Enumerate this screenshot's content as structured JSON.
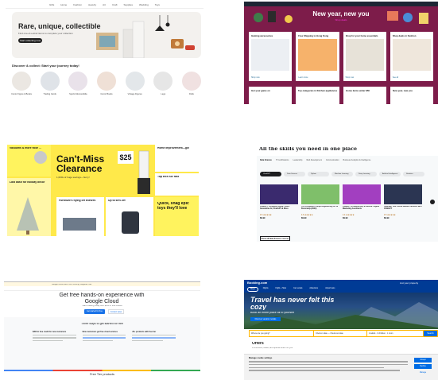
{
  "etsy": {
    "nav": [
      "Gifts",
      "Home",
      "Fashion",
      "Jewelry",
      "Art",
      "Craft",
      "Supplies",
      "Wedding",
      "Toys"
    ],
    "hero_title": "Rare, unique, collectible",
    "hero_sub": "Find one-of-a-kind items to complete your collection",
    "hero_cta": "Start collecting now",
    "journey": "Discover & collect: Start your journey today!",
    "circles": [
      "Comic Figure & Books",
      "Trading Cards",
      "Sports Memorabilia",
      "Comic Books",
      "Vintage Figures",
      "Lego",
      "Dolls"
    ]
  },
  "newyear": {
    "title": "New year, new you",
    "subtitle": "Shop deals",
    "cards": [
      {
        "title": "Gaming accessories",
        "link": "Shop now"
      },
      {
        "title": "Free Shipping to Hong Kong",
        "link": "Learn more"
      },
      {
        "title": "Shop for your home essentials",
        "link": "Shop now"
      },
      {
        "title": "Shop deals in Fashion",
        "link": "See all"
      }
    ],
    "row2": [
      "Get your game on",
      "Top categories in Kitchen appliances",
      "Home items under $50",
      "New year, new you"
    ]
  },
  "clearance": {
    "left_title": "Vacuums & more floor ...",
    "left_dash": "Last dash for holiday decor",
    "big": "Can't-Miss Clearance",
    "big_sub": "1,000s of huge savings—hurry!",
    "price": "$25",
    "home_title": "Home improvement—go!",
    "tech_title": "Top tech so! fast",
    "furniture_title": "Furniture's flying off shelves",
    "upto": "Up to 65% off",
    "toys_title": "Quick, snag epic toys they'll love"
  },
  "skills": {
    "title": "All the skills you need in one place",
    "tabs": [
      "Data Science",
      "IT Certifications",
      "Leadership",
      "Web Development",
      "Communication",
      "Business Analytics & Intelligence"
    ],
    "chips": [
      "ChatGPT",
      "Data Science",
      "Python",
      "Machine Learning",
      "Deep Learning",
      "Artificial Intelligence",
      "Statistics"
    ],
    "cards": [
      {
        "title": "ChatGPT Complete Guide: Learn Generative AI, ChatGPT & More",
        "rating": "4.5 ★★★★★",
        "price": "$9.99"
      },
      {
        "title": "The Complete Prompt Engineering for AI Bootcamp (2024)",
        "rating": "4.6 ★★★★★",
        "price": "$9.99"
      },
      {
        "title": "ChatGPT & Midjourney & Gemini: Digital Marketing Assistants",
        "rating": "4.4 ★★★★★",
        "price": "$9.99"
      },
      {
        "title": "Upgrade Your Social Media Presence with ChatGPT",
        "rating": "4.5 ★★★★★",
        "price": "$9.99"
      }
    ],
    "button": "Show all Data Science courses"
  },
  "gcp": {
    "banner": "Google Cloud Next '24 is coming. Register now.",
    "title": "Get free hands-on experience with Google Cloud",
    "sub": "Start building today with $300 in free credits",
    "btn_primary": "Get started for free",
    "btn_secondary": "Contact sales",
    "section_title": "Three ways to get started for free",
    "cols": [
      "$300 in free credit for new customers",
      "New customers get free cloud services",
      "20+ products with free tier"
    ],
    "free_tier": "Free Tier products"
  },
  "booking": {
    "logo": "Booking.com",
    "cta": "List your property",
    "pills": [
      "Stays",
      "Flights",
      "Flight + Hotel",
      "Car rentals",
      "Attractions",
      "Airport taxis"
    ],
    "h1": "Travel has never felt this cozy",
    "h2": "Book an entire place all to yourself",
    "btn": "Discover vacation rentals",
    "search": [
      "Where are you going?",
      "Check-in date — Check-out date",
      "2 adults · 0 children · 1 room"
    ],
    "search_btn": "Search",
    "offers": "Offers",
    "offers_sub": "Promotions, deals, and special offers for you",
    "cookie_title": "Manage cookie settings",
    "accept": "Accept",
    "decline": "Decline",
    "prefs": "Manage"
  }
}
